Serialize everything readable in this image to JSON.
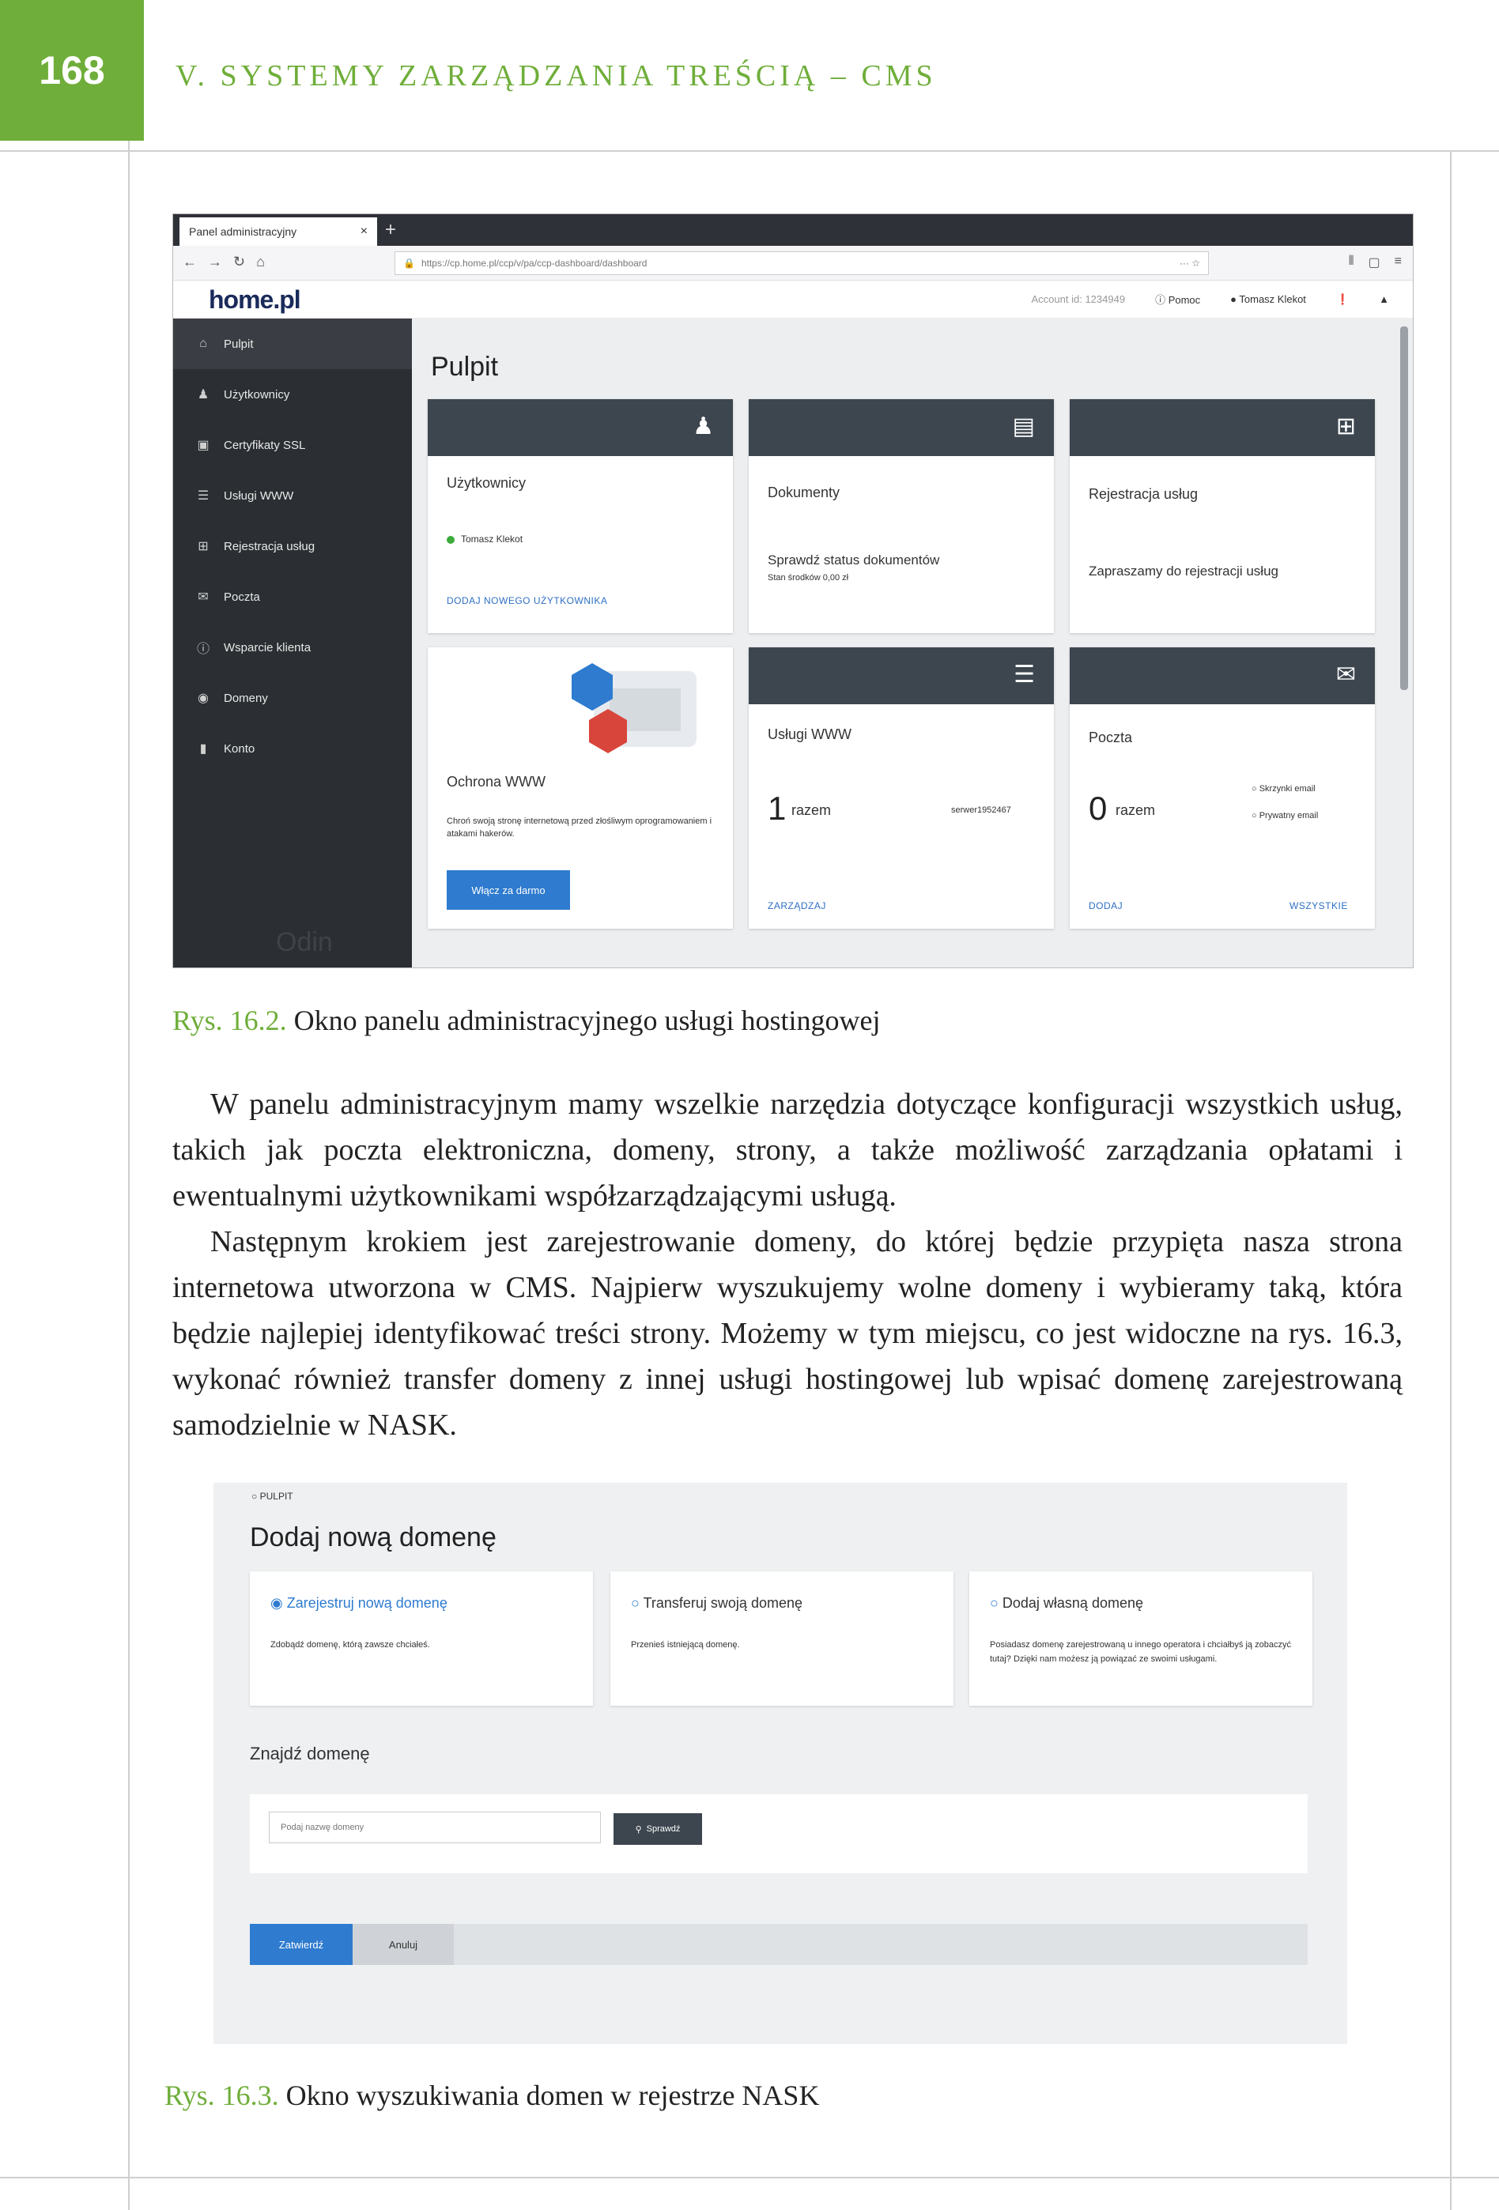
{
  "header": {
    "page_number": "168",
    "chapter_title": "V. SYSTEMY ZARZĄDZANIA TREŚCIĄ – CMS"
  },
  "colors": {
    "accent_green": "#6fae3a",
    "panel_dark": "#2b2f33",
    "card_head": "#3d464f",
    "link_blue": "#2e7bcf"
  },
  "figure1": {
    "browser": {
      "tab_title": "Panel administracyjny",
      "url": "https://cp.home.pl/ccp/v/pa/ccp-dashboard/dashboard"
    },
    "app": {
      "logo": "home.pl",
      "account_id": "Account id: 1234949",
      "help": "Pomoc",
      "user": "Tomasz Klekot"
    },
    "sidebar": [
      {
        "label": "Pulpit",
        "icon": "home-icon"
      },
      {
        "label": "Użytkownicy",
        "icon": "users-icon"
      },
      {
        "label": "Certyfikaty SSL",
        "icon": "lock-icon"
      },
      {
        "label": "Usługi WWW",
        "icon": "server-icon"
      },
      {
        "label": "Rejestracja usług",
        "icon": "cart-icon"
      },
      {
        "label": "Poczta",
        "icon": "mail-icon"
      },
      {
        "label": "Wsparcie klienta",
        "icon": "info-icon"
      },
      {
        "label": "Domeny",
        "icon": "globe-icon"
      },
      {
        "label": "Konto",
        "icon": "bars-icon"
      }
    ],
    "sidebar_footer": "Odin",
    "main_title": "Pulpit",
    "cards": {
      "users": {
        "title": "Użytkownicy",
        "user": "Tomasz Klekot",
        "link": "DODAJ NOWEGO UŻYTKOWNIKA"
      },
      "documents": {
        "title": "Dokumenty",
        "status": "Sprawdź status dokumentów",
        "balance": "Stan środków 0,00 zł"
      },
      "registration": {
        "title": "Rejestracja usług",
        "text": "Zapraszamy do rejestracji usług"
      },
      "protection": {
        "title": "Ochrona WWW",
        "text": "Chroń swoją stronę internetową przed złośliwym oprogramowaniem i atakami hakerów.",
        "button": "Włącz za darmo"
      },
      "www": {
        "title": "Usługi WWW",
        "count": "1",
        "unit": "razem",
        "server": "serwer1952467",
        "link": "ZARZĄDZAJ"
      },
      "mail": {
        "title": "Poczta",
        "count": "0",
        "unit": "razem",
        "item1": "Skrzynki email",
        "item2": "Prywatny email",
        "link_left": "DODAJ",
        "link_right": "WSZYSTKIE"
      }
    },
    "caption_number": "Rys. 16.2.",
    "caption_text": "Okno panelu administracyjnego usługi hostingowej"
  },
  "body": {
    "paragraph1": "W panelu administracyjnym mamy wszelkie narzędzia dotyczące konfiguracji wszystkich usług, takich jak poczta elektroniczna, domeny, strony, a także możliwość zarządzania opłatami i ewentualnymi użytkownikami współzarządzającymi usługą.",
    "paragraph2": "Następnym krokiem jest zarejestrowanie domeny, do której będzie przypięta nasza strona internetowa utworzona w CMS. Najpierw wyszukujemy wolne domeny i wybieramy taką, która będzie najlepiej identyfikować treści strony. Możemy w tym miejscu, co jest widoczne na rys. 16.3, wykonać również transfer domeny z innej usługi hostingowej lub wpisać domenę zarejestrowaną samodzielnie w NASK."
  },
  "figure2": {
    "breadcrumb": "PULPIT",
    "title": "Dodaj nową domenę",
    "options": [
      {
        "label": "Zarejestruj nową domenę",
        "desc": "Zdobądź domenę, którą zawsze chciałeś.",
        "selected": true
      },
      {
        "label": "Transferuj swoją domenę",
        "desc": "Przenieś istniejącą domenę.",
        "selected": false
      },
      {
        "label": "Dodaj własną domenę",
        "desc": "Posiadasz domenę zarejestrowaną u innego operatora i chciałbyś ją zobaczyć tutaj? Dzięki nam możesz ją powiązać ze swoimi usługami.",
        "selected": false
      }
    ],
    "find_label": "Znajdź domenę",
    "search_placeholder": "Podaj nazwę domeny",
    "search_button": "Sprawdź",
    "confirm_button": "Zatwierdź",
    "cancel_button": "Anuluj",
    "caption_number": "Rys. 16.3.",
    "caption_text": "Okno wyszukiwania domen w rejestrze NASK"
  }
}
